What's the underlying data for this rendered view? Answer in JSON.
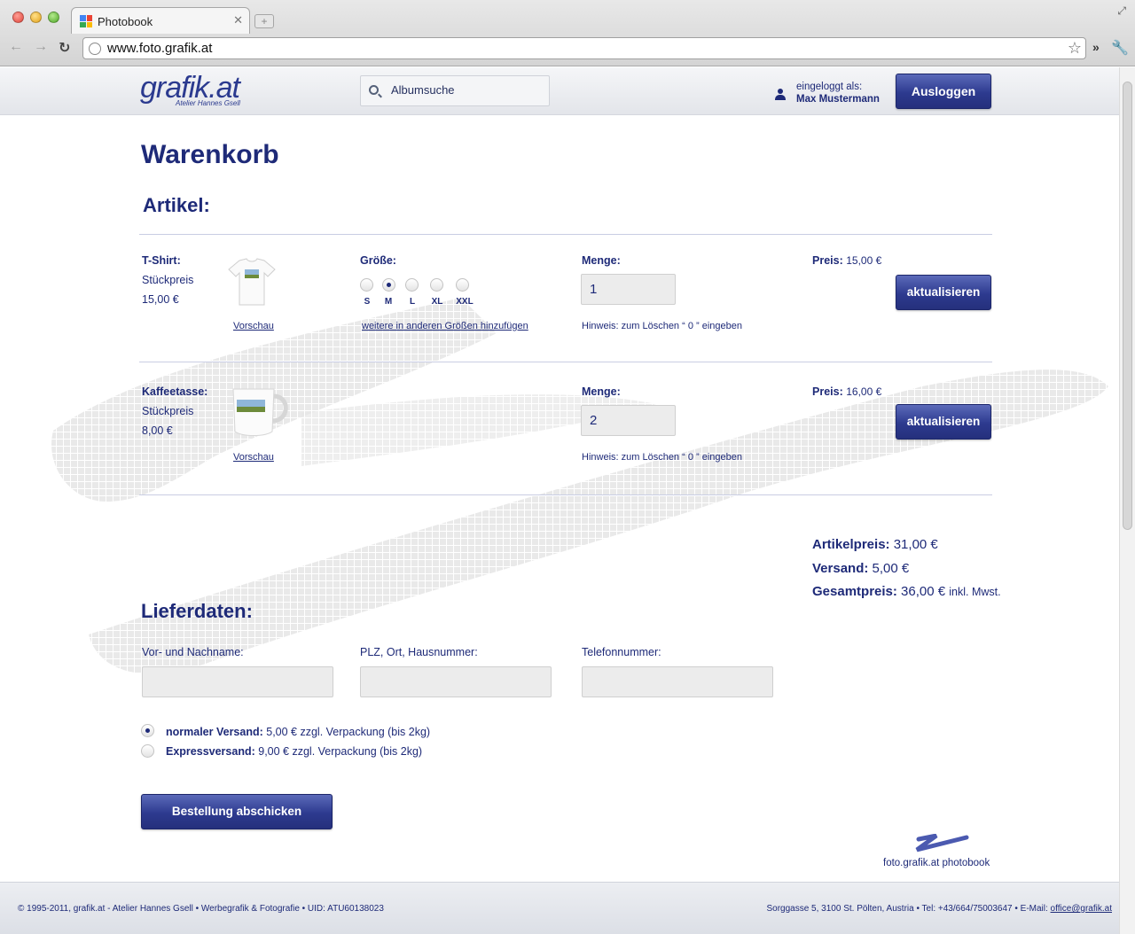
{
  "browser": {
    "tab_title": "Photobook",
    "url": "www.foto.grafik.at"
  },
  "header": {
    "logo_text": "grafik.at",
    "logo_subtitle": "Atelier Hannes Gsell",
    "search_placeholder": "Albumsuche",
    "login_label": "eingeloggt als:",
    "login_name": "Max Mustermann",
    "logout_label": "Ausloggen"
  },
  "cart": {
    "title": "Warenkorb",
    "items_heading": "Artikel:",
    "items": [
      {
        "name": "T-Shirt:",
        "unit_label": "Stückpreis",
        "unit_price": "15,00 €",
        "preview_link": "Vorschau",
        "size_label": "Größe:",
        "sizes": [
          "S",
          "M",
          "L",
          "XL",
          "XXL"
        ],
        "selected_size": "M",
        "more_sizes_link": "weitere in anderen Größen hinzufügen",
        "qty_label": "Menge:",
        "qty": "1",
        "hint": "Hinweis: zum Löschen “ 0 ” eingeben",
        "price_label": "Preis:",
        "price": "15,00 €",
        "update_label": "aktualisieren"
      },
      {
        "name": "Kaffeetasse:",
        "unit_label": "Stückpreis",
        "unit_price": "8,00 €",
        "preview_link": "Vorschau",
        "qty_label": "Menge:",
        "qty": "2",
        "hint": "Hinweis: zum Löschen “ 0 ” eingeben",
        "price_label": "Preis:",
        "price": "16,00 €",
        "update_label": "aktualisieren"
      }
    ],
    "summary": {
      "article_label": "Artikelpreis:",
      "article_value": "31,00 €",
      "shipping_label": "Versand:",
      "shipping_value": "5,00 €",
      "total_label": "Gesamtpreis:",
      "total_value": "36,00 €",
      "total_suffix": "inkl. Mwst."
    }
  },
  "delivery": {
    "heading": "Lieferdaten:",
    "name_label": "Vor- und Nachname:",
    "address_label": "PLZ, Ort, Hausnummer:",
    "phone_label": "Telefonnummer:",
    "shipping_options": [
      {
        "label": "normaler Versand:",
        "detail": "5,00 € zzgl. Verpackung (bis 2kg)",
        "checked": true
      },
      {
        "label": "Expressversand:",
        "detail": "9,00 € zzgl. Verpackung (bis 2kg)",
        "checked": false
      }
    ],
    "submit_label": "Bestellung abschicken"
  },
  "footer": {
    "brand": "foto.grafik.at photobook",
    "copyright": "© 1995-2011, grafik.at - Atelier Hannes Gsell • Werbegrafik & Fotografie • UID: ATU60138023",
    "address": "Sorggasse 5, 3100 St. Pölten, Austria • Tel: +43/664/75003647 • E-Mail: ",
    "email": "office@grafik.at"
  },
  "colors": {
    "brand": "#1e2a78",
    "button": "#2d3a8f"
  }
}
